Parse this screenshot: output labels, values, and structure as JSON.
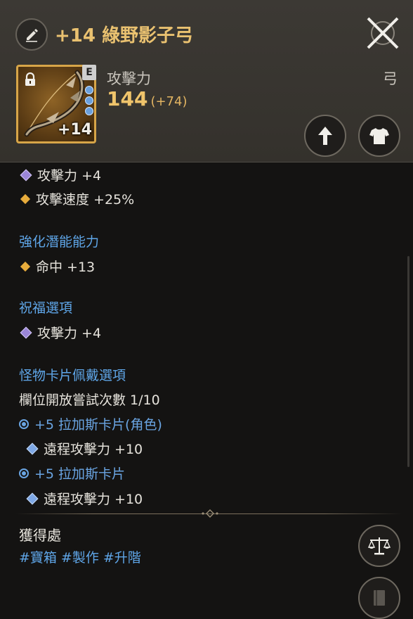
{
  "header": {
    "title": "+14 綠野影子弓",
    "grade": "E",
    "enhance_level": "+14",
    "stat_label": "攻擊力",
    "stat_value": "144",
    "stat_bonus": "(+74)",
    "weapon_type": "弓"
  },
  "base_options": [
    {
      "text": "攻擊力 +4",
      "icon": "purple-diamond"
    },
    {
      "text": "攻擊速度 +25%",
      "icon": "gold-diamond"
    }
  ],
  "enhance_potential": {
    "title": "強化潛能能力",
    "items": [
      {
        "text": "命中 +13",
        "icon": "gold-diamond"
      }
    ]
  },
  "blessing": {
    "title": "祝福選項",
    "items": [
      {
        "text": "攻擊力 +4",
        "icon": "purple-diamond"
      }
    ]
  },
  "monster_card": {
    "title": "怪物卡片佩戴選項",
    "slot_attempts": "欄位開放嘗試次數 1/10",
    "cards": [
      {
        "name": "+5 拉加斯卡片(角色)",
        "effect": "遠程攻擊力 +10"
      },
      {
        "name": "+5 拉加斯卡片",
        "effect": "遠程攻擊力 +10"
      }
    ]
  },
  "source": {
    "title": "獲得處",
    "tags": [
      "#寶箱",
      "#製作",
      "#升階"
    ]
  },
  "colors": {
    "title_gold": "#e9c170",
    "section_blue": "#5fa6e8",
    "frame_gold": "#d7a548"
  }
}
